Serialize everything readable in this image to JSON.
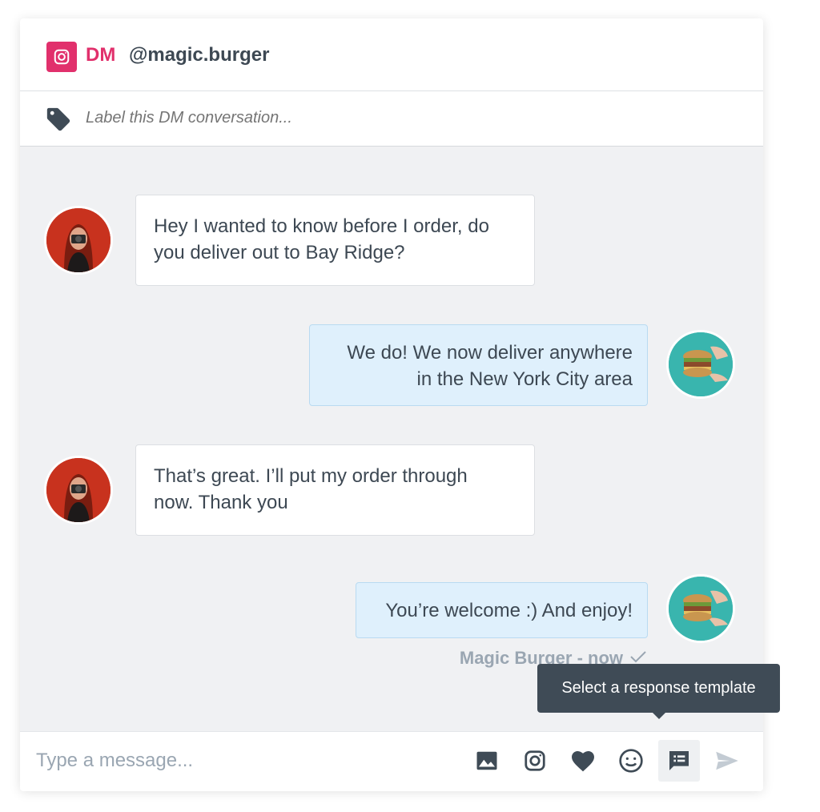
{
  "header": {
    "platform_icon": "instagram-icon",
    "channel": "DM",
    "handle": "@magic.burger"
  },
  "label_bar": {
    "icon": "tag-icon",
    "placeholder": "Label this DM conversation..."
  },
  "messages": [
    {
      "direction": "incoming",
      "text_lines": [
        "Hey I wanted to know before I order, do",
        "you deliver out to Bay Ridge?"
      ]
    },
    {
      "direction": "outgoing",
      "text_lines": [
        "We do! We now deliver anywhere",
        "in the New York City area"
      ]
    },
    {
      "direction": "incoming",
      "text_lines": [
        "That’s great. I’ll put my order through",
        "now. Thank you"
      ]
    },
    {
      "direction": "outgoing",
      "text_lines": [
        "You’re welcome :) And enjoy!"
      ]
    }
  ],
  "last_message_meta": {
    "text": "Magic Burger - now",
    "status_icon": "checkmark-icon"
  },
  "tooltip": {
    "text": "Select a response template"
  },
  "composer": {
    "placeholder": "Type a message...",
    "tools": [
      "image-icon",
      "instagram-icon",
      "heart-icon",
      "emoji-icon",
      "response-template-icon",
      "send-icon"
    ]
  },
  "colors": {
    "instagram_brand": "#e1306c",
    "outgoing_bubble": "#dff0fc",
    "tooltip_bg": "#3f4b56"
  }
}
